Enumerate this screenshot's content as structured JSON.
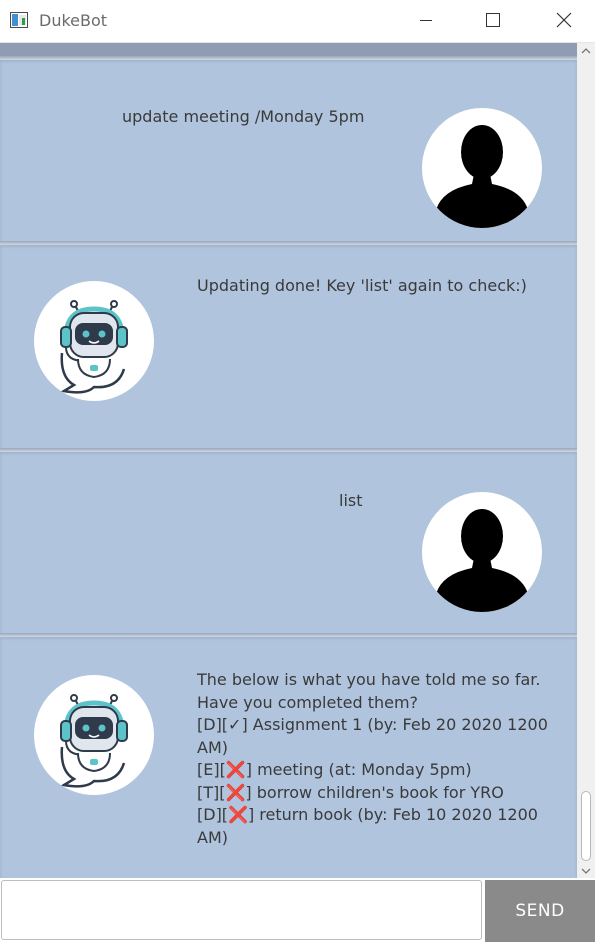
{
  "window": {
    "title": "DukeBot"
  },
  "messages": [
    {
      "sender": "user",
      "text": "update meeting /Monday 5pm"
    },
    {
      "sender": "bot",
      "text": "Updating done! Key 'list' again to check:)"
    },
    {
      "sender": "user",
      "text": "list"
    },
    {
      "sender": "bot",
      "text": "The below is what you have told me so far.\nHave you completed them?\n[D][✓] Assignment 1 (by: Feb 20 2020 1200\nAM)\n[E][❌] meeting (at: Monday 5pm)\n[T][❌] borrow children's book for YRO\n[D][❌] return book (by: Feb 10 2020 1200\nAM)"
    }
  ],
  "input": {
    "value": "",
    "placeholder": ""
  },
  "send_button": {
    "label": "SEND"
  },
  "colors": {
    "dialog_background": "#b0c4de",
    "send_button": "#8a8a8a",
    "bot_headset": "#5cc4c9",
    "bot_face": "#2f3a4a"
  },
  "icons": {
    "app": "app-window-icon",
    "user_avatar": "person-silhouette-icon",
    "bot_avatar": "robot-headset-icon"
  }
}
